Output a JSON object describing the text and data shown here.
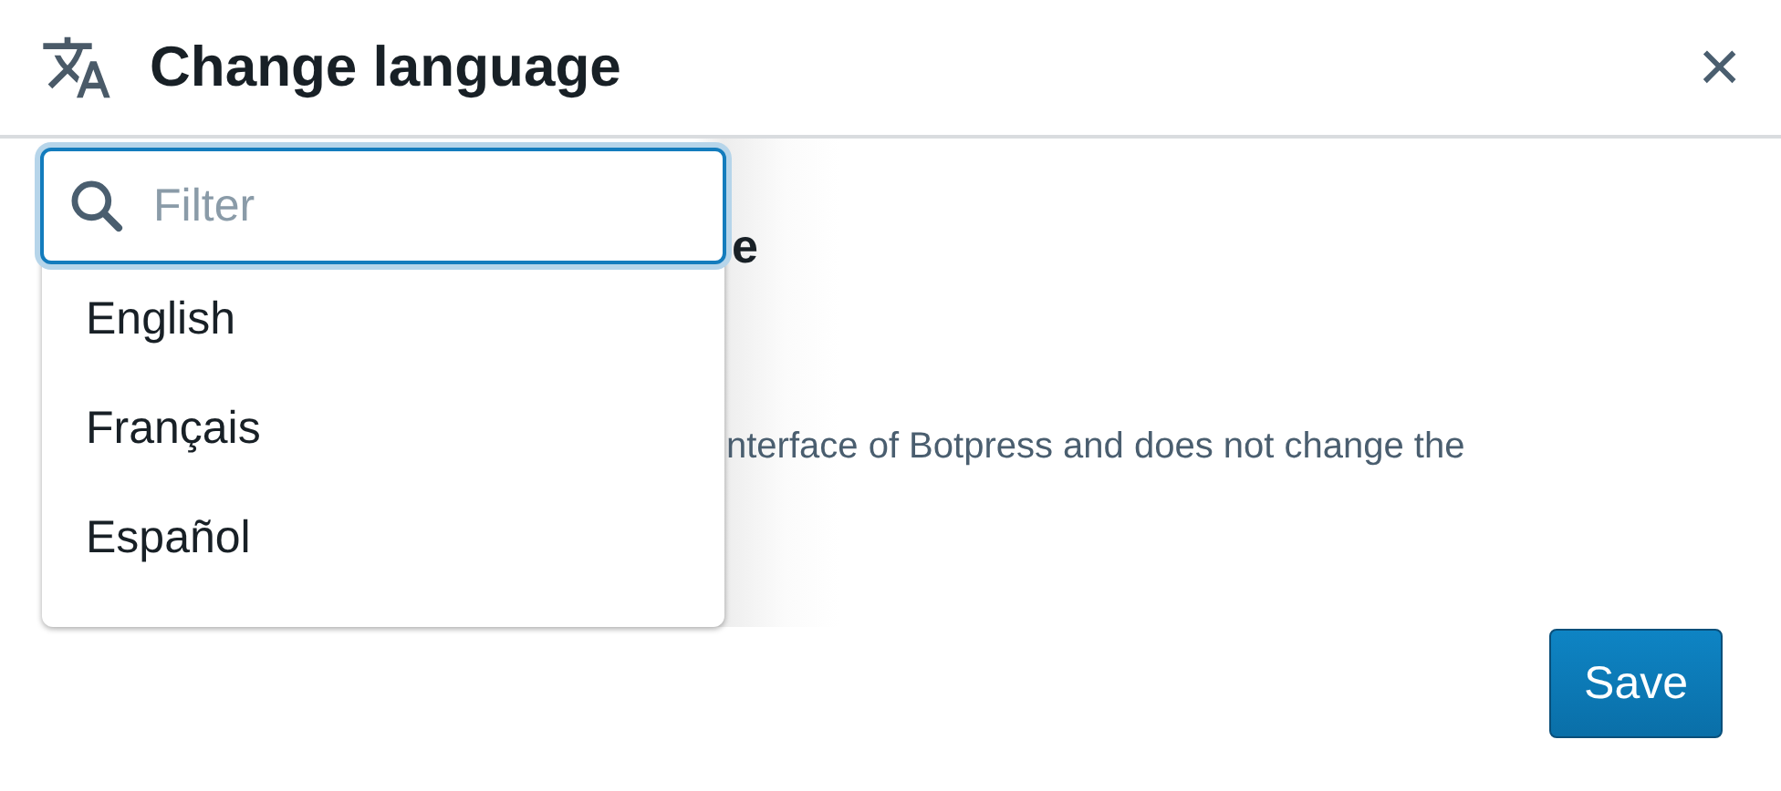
{
  "dialog": {
    "title": "Change language",
    "close": "×"
  },
  "body": {
    "heading_fragment": "e",
    "text_fragment": "nterface of Botpress and does not change the"
  },
  "dropdown": {
    "search": {
      "placeholder": "Filter"
    },
    "options": [
      {
        "label": "English"
      },
      {
        "label": "Français"
      },
      {
        "label": "Español"
      }
    ]
  },
  "buttons": [
    {
      "label": "Save",
      "kind": "primary"
    }
  ]
}
